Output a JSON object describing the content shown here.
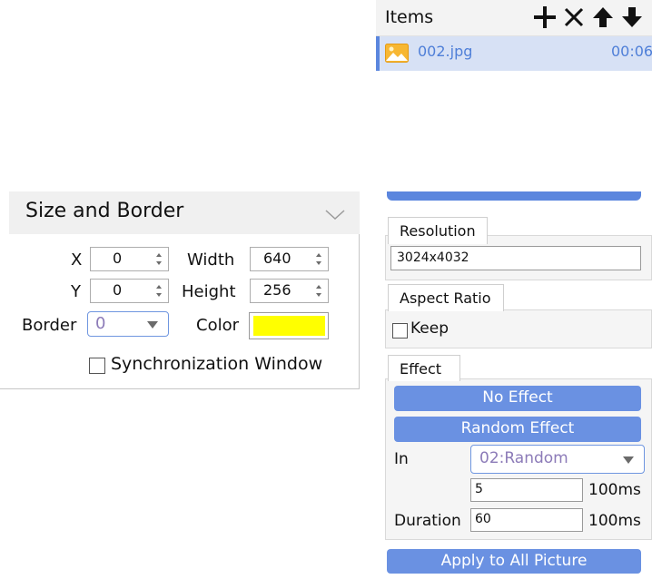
{
  "items_panel": {
    "title": "Items",
    "icons": [
      "plus-icon",
      "close-icon",
      "arrow-up-icon",
      "arrow-down-icon"
    ],
    "rows": [
      {
        "name": "002.jpg",
        "duration": "00:06",
        "icon": "image-icon"
      }
    ]
  },
  "size_border": {
    "title": "Size and Border",
    "x_label": "X",
    "x_value": "0",
    "y_label": "Y",
    "y_value": "0",
    "width_label": "Width",
    "width_value": "640",
    "height_label": "Height",
    "height_value": "256",
    "border_label": "Border",
    "border_value": "0",
    "color_label": "Color",
    "color_value": "#ffff00",
    "sync_label": "Synchronization Window",
    "sync_checked": false
  },
  "properties": {
    "resolution_tab": "Resolution",
    "resolution_value": "3024x4032",
    "aspect_tab": "Aspect Ratio",
    "keep_label": "Keep",
    "keep_checked": false,
    "effect_tab": "Effect",
    "no_effect_label": "No Effect",
    "random_effect_label": "Random Effect",
    "in_label": "In",
    "in_value": "02:Random",
    "in_ms_value": "5",
    "in_ms_unit": "100ms",
    "duration_label": "Duration",
    "duration_value": "60",
    "duration_unit": "100ms",
    "apply_all_label": "Apply to All Picture"
  },
  "colors": {
    "accent": "#6a91e2",
    "selection": "#d7e1f5",
    "link_text": "#4f7fd8",
    "dropdown_text": "#8c7bb8"
  }
}
